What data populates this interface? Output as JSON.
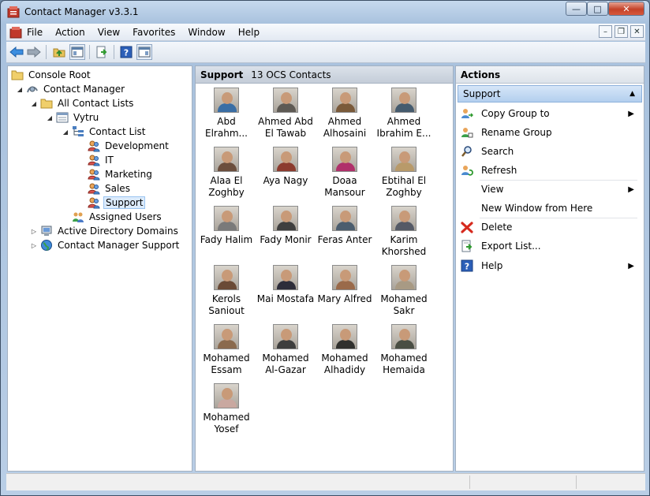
{
  "window": {
    "title": "Contact Manager v3.3.1"
  },
  "menu": [
    "File",
    "Action",
    "View",
    "Favorites",
    "Window",
    "Help"
  ],
  "tree": [
    {
      "label": "Console Root",
      "level": 0,
      "icon": "folder-icon",
      "arrow": ""
    },
    {
      "label": "Contact Manager",
      "level": 1,
      "icon": "contact-manager-icon",
      "arrow": "expanded"
    },
    {
      "label": "All Contact Lists",
      "level": 2,
      "icon": "folder-icon",
      "arrow": "expanded"
    },
    {
      "label": "Vytru",
      "level": 3,
      "icon": "list-icon",
      "arrow": "expanded"
    },
    {
      "label": "Contact List",
      "level": 4,
      "icon": "tree-list-icon",
      "arrow": "expanded"
    },
    {
      "label": "Development",
      "level": 5,
      "icon": "group-icon",
      "arrow": ""
    },
    {
      "label": "IT",
      "level": 5,
      "icon": "group-icon",
      "arrow": ""
    },
    {
      "label": "Marketing",
      "level": 5,
      "icon": "group-icon",
      "arrow": ""
    },
    {
      "label": "Sales",
      "level": 5,
      "icon": "group-icon",
      "arrow": ""
    },
    {
      "label": "Support",
      "level": 5,
      "icon": "group-icon",
      "arrow": "",
      "selected": true
    },
    {
      "label": "Assigned Users",
      "level": 4,
      "icon": "users-icon",
      "arrow": ""
    },
    {
      "label": "Active Directory Domains",
      "level": 2,
      "icon": "domains-icon",
      "arrow": "collapsed"
    },
    {
      "label": "Contact Manager Support",
      "level": 2,
      "icon": "globe-icon",
      "arrow": "collapsed"
    }
  ],
  "center": {
    "group": "Support",
    "count_label": "13 OCS Contacts",
    "contacts": [
      {
        "name": "Abd Elrahm...",
        "color": "#3a6ea5"
      },
      {
        "name": "Ahmed Abd El Tawab",
        "color": "#5e5a54"
      },
      {
        "name": "Ahmed Alhosaini",
        "color": "#7a5a3a"
      },
      {
        "name": "Ahmed Ibrahim E...",
        "color": "#455b6e"
      },
      {
        "name": "Alaa El Zoghby",
        "color": "#6b4e3d"
      },
      {
        "name": "Aya Nagy",
        "color": "#8c3b2e"
      },
      {
        "name": "Doaa Mansour",
        "color": "#b0306a"
      },
      {
        "name": "Ebtihal El Zoghby",
        "color": "#b89a6a"
      },
      {
        "name": "Fady Halim",
        "color": "#7a7a7a"
      },
      {
        "name": "Fady Monir",
        "color": "#3f3f3f"
      },
      {
        "name": "Feras Anter",
        "color": "#4b5d6e"
      },
      {
        "name": "Karim Khorshed",
        "color": "#555a66"
      },
      {
        "name": "Kerols Saniout",
        "color": "#6a4a36"
      },
      {
        "name": "Mai Mostafa",
        "color": "#2d2d3a"
      },
      {
        "name": "Mary Alfred",
        "color": "#9a6a4a"
      },
      {
        "name": "Mohamed Sakr",
        "color": "#a89a84"
      },
      {
        "name": "Mohamed Essam",
        "color": "#8a6a4e"
      },
      {
        "name": "Mohamed Al-Gazar",
        "color": "#3e3e3e"
      },
      {
        "name": "Mohamed Alhadidy",
        "color": "#30302e"
      },
      {
        "name": "Mohamed Hemaida",
        "color": "#4a4e44"
      },
      {
        "name": "Mohamed Yosef",
        "color": "#c9a8a0"
      }
    ]
  },
  "actions": {
    "header": "Actions",
    "group": "Support",
    "items": [
      {
        "label": "Copy Group to",
        "icon": "copy-group-icon",
        "submenu": true
      },
      {
        "label": "Rename Group",
        "icon": "rename-group-icon",
        "submenu": false
      },
      {
        "label": "Search",
        "icon": "search-icon",
        "submenu": false
      },
      {
        "label": "Refresh",
        "icon": "refresh-icon",
        "submenu": false
      },
      {
        "label": "View",
        "icon": "",
        "submenu": true
      },
      {
        "label": "New Window from Here",
        "icon": "",
        "submenu": false
      },
      {
        "label": "Delete",
        "icon": "delete-icon",
        "submenu": false
      },
      {
        "label": "Export List...",
        "icon": "export-icon",
        "submenu": false
      },
      {
        "label": "Help",
        "icon": "help-icon",
        "submenu": true
      }
    ]
  }
}
